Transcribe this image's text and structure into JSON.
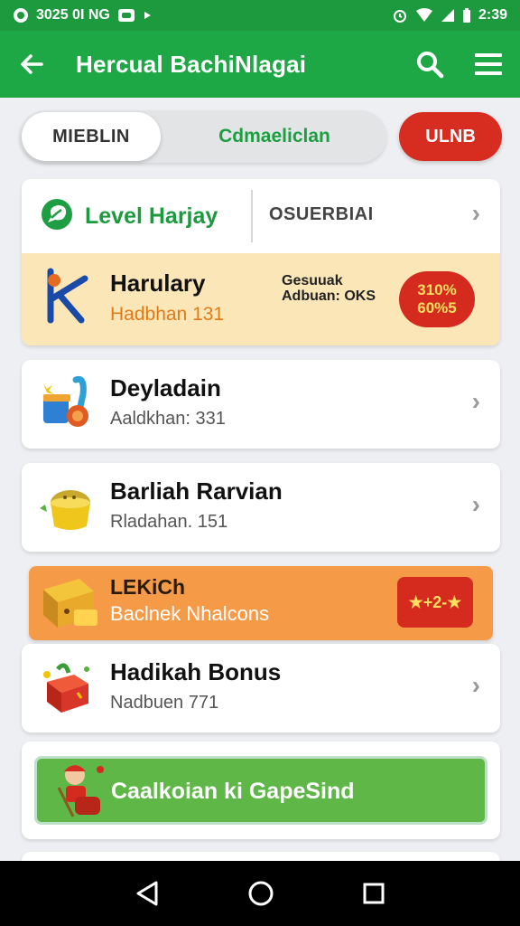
{
  "status_bar": {
    "left_text": "3025 0I NG",
    "time": "2:39"
  },
  "app_bar": {
    "title": "Hercual BachiNlagai"
  },
  "segments": {
    "tab1": "MIEBLIN",
    "tab2": "Cdmaeliclan",
    "pill": "ULNB"
  },
  "level_card": {
    "title": "Level Harjay",
    "subtitle": "OSUERBIAI",
    "item": {
      "title": "Harulary",
      "sub": "Hadbhan 131",
      "mid_line1": "Gesuuak",
      "mid_line2": "Adbuan: OKS",
      "badge_line1": "310%",
      "badge_line2": "60%5"
    }
  },
  "list_items": [
    {
      "title": "Deyladain",
      "sub": "Aaldkhan: 331"
    },
    {
      "title": "Barliah Rarvian",
      "sub": "Rladahan. 151"
    }
  ],
  "promo": {
    "title": "LEKiCh",
    "sub": "Baclnek Nhalcons",
    "badge": "★+2-★"
  },
  "bonus": {
    "title": "Hadikah Bonus",
    "sub": "Nadbuen 771"
  },
  "game_button": {
    "label": "Caalkoian ki GapeSind"
  },
  "colors": {
    "primary_green": "#1ea845",
    "accent_red": "#d52a1e",
    "promo_orange": "#f59b48",
    "level_highlight": "#fbe6b8"
  }
}
